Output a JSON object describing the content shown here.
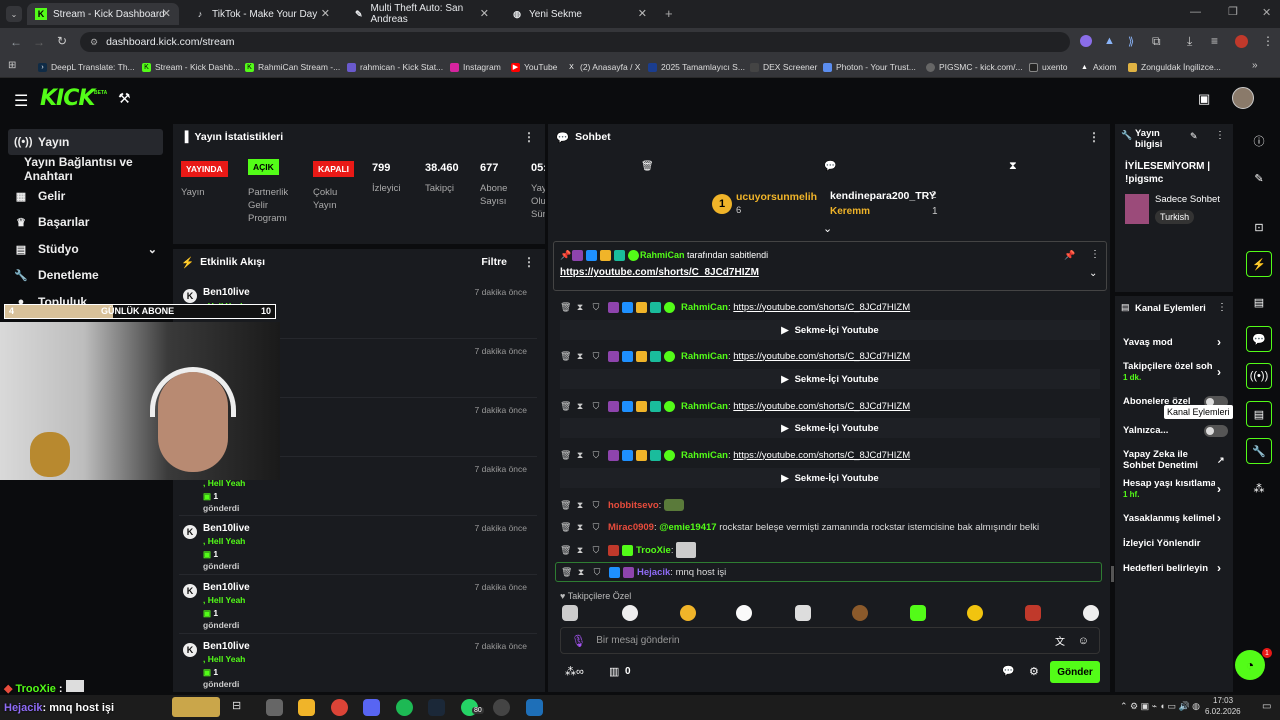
{
  "browser": {
    "tabs": [
      {
        "title": "Stream - Kick Dashboard",
        "icon": "kick-icon",
        "active": true
      },
      {
        "title": "TikTok - Make Your Day",
        "icon": "tiktok-icon"
      },
      {
        "title": "Multi Theft Auto: San Andreas",
        "icon": "mta-icon"
      },
      {
        "title": "Yeni Sekme",
        "icon": "globe-icon"
      }
    ],
    "url": "dashboard.kick.com/stream",
    "bookmarks": [
      "DeepL Translate: Th...",
      "Stream - Kick Dashb...",
      "RahmiCan Stream -...",
      "rahmican - Kick Stat...",
      "Instagram",
      "YouTube",
      "(2) Anasayfa / X",
      "2025 Tamamlayıcı S...",
      "DEX Screener",
      "Photon - Your Trust...",
      "PIGSMC - kick.com/...",
      "uxento",
      "Axiom",
      "Zonguldak İngilizce..."
    ]
  },
  "header": {
    "logo": "KICK",
    "beta": "BETA"
  },
  "sidebar": {
    "items": [
      {
        "label": "Yayın",
        "icon": "broadcast-icon"
      },
      {
        "label": "Yayın Bağlantısı ve Anahtarı"
      },
      {
        "label": "Gelir",
        "icon": "money-icon"
      },
      {
        "label": "Başarılar",
        "icon": "trophy-icon"
      },
      {
        "label": "Stüdyo",
        "icon": "studio-icon"
      },
      {
        "label": "Denetleme",
        "icon": "wrench-icon"
      },
      {
        "label": "Topluluk",
        "icon": "community-icon"
      }
    ]
  },
  "overlay": {
    "left_num": "4",
    "title": "GÜNLÜK ABONE",
    "right_num": "10",
    "progress": 0.4
  },
  "stats": {
    "title": "Yayın İstatistikleri",
    "badges": [
      {
        "badge": "YAYINDA",
        "label": "Yayın",
        "color": "#e91916"
      },
      {
        "badge": "AÇIK",
        "label": "Partnerlik Gelir Programı",
        "color": "#53fc18"
      },
      {
        "badge": "KAPALI",
        "label": "Çoklu Yayın",
        "color": "#e91916"
      }
    ],
    "numbers": [
      {
        "value": "799",
        "label": "İzleyici"
      },
      {
        "value": "38.460",
        "label": "Takipçi"
      },
      {
        "value": "677",
        "label": "Abone Sayısı"
      },
      {
        "value": "05:",
        "label": "Yay Olu Sür"
      }
    ]
  },
  "activity": {
    "title": "Etkinlik Akışı",
    "filter": "Filtre",
    "rows": [
      {
        "name": "Ben10live",
        "sub": ", Hell Yeah",
        "count": "1",
        "time": "7 dakika önce"
      },
      {
        "name": "",
        "sub": "",
        "count": "",
        "time": "7 dakika önce"
      },
      {
        "name": "",
        "sub": "",
        "count": "",
        "time": "7 dakika önce"
      },
      {
        "name": "",
        "sub": ", Hell Yeah",
        "count": "1",
        "sent": "gönderdi",
        "time": "7 dakika önce"
      },
      {
        "name": "Ben10live",
        "sub": ", Hell Yeah",
        "count": "1",
        "sent": "gönderdi",
        "time": "7 dakika önce"
      },
      {
        "name": "Ben10live",
        "sub": ", Hell Yeah",
        "count": "1",
        "sent": "gönderdi",
        "time": "7 dakika önce"
      },
      {
        "name": "Ben10live",
        "sub": ", Hell Yeah",
        "count": "1",
        "sent": "gönderdi",
        "time": "7 dakika önce"
      }
    ]
  },
  "chat": {
    "title": "Sohbet",
    "top_gifters": [
      {
        "rank": "1",
        "name": "ucuyorsunmelih",
        "count": "6"
      },
      {
        "name": "kendinepara200_TRY",
        "count": "2"
      },
      {
        "name": "Keremm",
        "count": "1"
      }
    ],
    "pinned": {
      "by": "RahmiCan",
      "by_text": "tarafından sabitlendi",
      "link": "https://youtube.com/shorts/C_8JCd7HIZM"
    },
    "messages": [
      {
        "user": "RahmiCan",
        "text": "https://youtube.com/shorts/C_8JCd7HIZM",
        "embed": "Sekme-İçi Youtube"
      },
      {
        "user": "RahmiCan",
        "text": "https://youtube.com/shorts/C_8JCd7HIZM",
        "embed": "Sekme-İçi Youtube"
      },
      {
        "user": "RahmiCan",
        "text": "https://youtube.com/shorts/C_8JCd7HIZM",
        "embed": "Sekme-İçi Youtube"
      },
      {
        "user": "RahmiCan",
        "text": "https://youtube.com/shorts/C_8JCd7HIZM",
        "embed": "Sekme-İçi Youtube"
      },
      {
        "user": "hobbitsevo",
        "text": ""
      },
      {
        "user": "Mirac0909",
        "mention": "@emie19417",
        "text": "rockstar beleşe vermişti zamanında rockstar istemcisine bak almışındır belki"
      },
      {
        "user": "TrooXie",
        "text": ""
      },
      {
        "user": "Hejacik",
        "text": "mnq host işi"
      }
    ],
    "followers_only": "Takipçilere Özel",
    "placeholder": "Bir mesaj gönderin",
    "send": "Gönder",
    "points": "0"
  },
  "stream_info": {
    "title": "Yayın bilgisi",
    "stream_title": "İYİLESEMİYORM | !pigsmc",
    "category": "Sadece Sohbet",
    "tag": "Turkish"
  },
  "channel_actions": {
    "title": "Kanal Eylemleri",
    "items": [
      {
        "label": "Yavaş mod"
      },
      {
        "label": "Takipçilere özel soh",
        "sub": "1 dk."
      },
      {
        "label": "Abonelere özel"
      },
      {
        "label": "Yalnızca..."
      },
      {
        "label": "Yapay Zeka ile Sohbet Denetimi"
      },
      {
        "label": "Hesap yaşı kısıtlama",
        "sub": "1 hf."
      },
      {
        "label": "Yasaklanmış kelimel"
      },
      {
        "label": "İzleyici Yönlendir"
      },
      {
        "label": "Hedefleri belirleyin"
      }
    ],
    "tooltip": "Kanal Eylemleri"
  },
  "stream_overlay_chat": [
    {
      "user": "TrooXie",
      "text": ""
    },
    {
      "user": "Hejacik",
      "text": "mnq host işi"
    }
  ],
  "taskbar": {
    "time": "17:03",
    "date": "6.02.2026",
    "whatsapp_badge": "80"
  },
  "colors": {
    "accent": "#53fc18",
    "live": "#e91916",
    "panel": "#191b1f",
    "bg": "#0b0c0e"
  }
}
